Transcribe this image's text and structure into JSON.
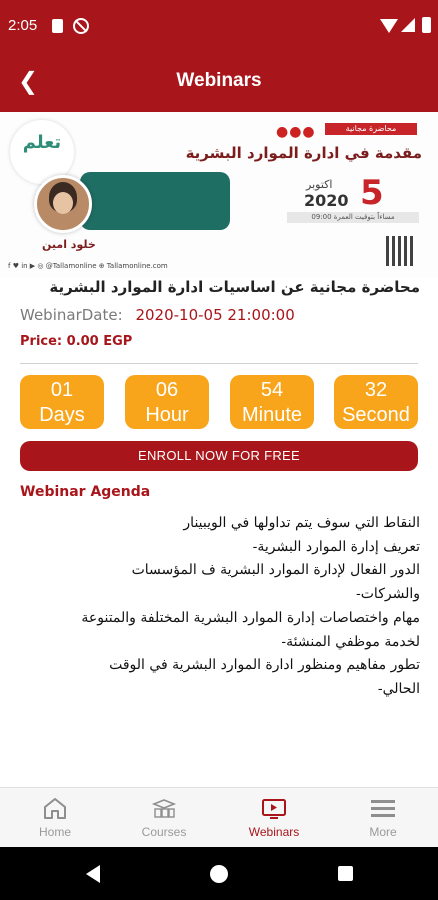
{
  "status_bar": {
    "time": "2:05"
  },
  "app_bar": {
    "back_icon": "chevron-left-icon",
    "title": "Webinars"
  },
  "banner": {
    "logo_text": "تعلم",
    "free_tag": "محاضرة مجانية",
    "title": "مقدمة في ادارة الموارد البشرية",
    "speaker_name": "خلود امين",
    "date_day": "5",
    "date_month": "اكتوبر",
    "date_year": "2020",
    "time_strip": "09:00 مساءاً بتوقيت العمرة",
    "socials": "f ♥ in ▶ ◎ @Tallamonline   ⊕ Tallamonline.com"
  },
  "webinar": {
    "title": "محاضرة مجانية عن اساسيات ادارة الموارد البشرية",
    "date_label": "WebinarDate:",
    "date_value": "2020-10-05 21:00:00",
    "price": "Price: 0.00 EGP"
  },
  "countdown": [
    {
      "value": "01",
      "unit": "Days"
    },
    {
      "value": "06",
      "unit": "Hour"
    },
    {
      "value": "54",
      "unit": "Minute"
    },
    {
      "value": "32",
      "unit": "Second"
    }
  ],
  "enroll_label": "ENROLL NOW FOR FREE",
  "agenda": {
    "title": "Webinar Agenda",
    "lines": [
      "النقاط التي سوف يتم تداولها في الويبينار",
      "تعريف إدارة الموارد البشرية-",
      "الدور الفعال لإدارة الموارد البشرية ف المؤسسات",
      "والشركات-",
      "مهام واختصاصات إدارة الموارد البشرية المختلفة والمتنوعة",
      "لخدمة موظفي المنشئة-",
      "تطور مفاهيم ومنظور ادارة الموارد البشرية في الوقت",
      "الحالي-"
    ]
  },
  "bottom_nav": [
    {
      "label": "Home",
      "icon": "home-icon"
    },
    {
      "label": "Courses",
      "icon": "courses-icon"
    },
    {
      "label": "Webinars",
      "icon": "webinar-icon"
    },
    {
      "label": "More",
      "icon": "menu-icon"
    }
  ],
  "colors": {
    "primary": "#a8161b",
    "counter": "#f8a51b"
  }
}
